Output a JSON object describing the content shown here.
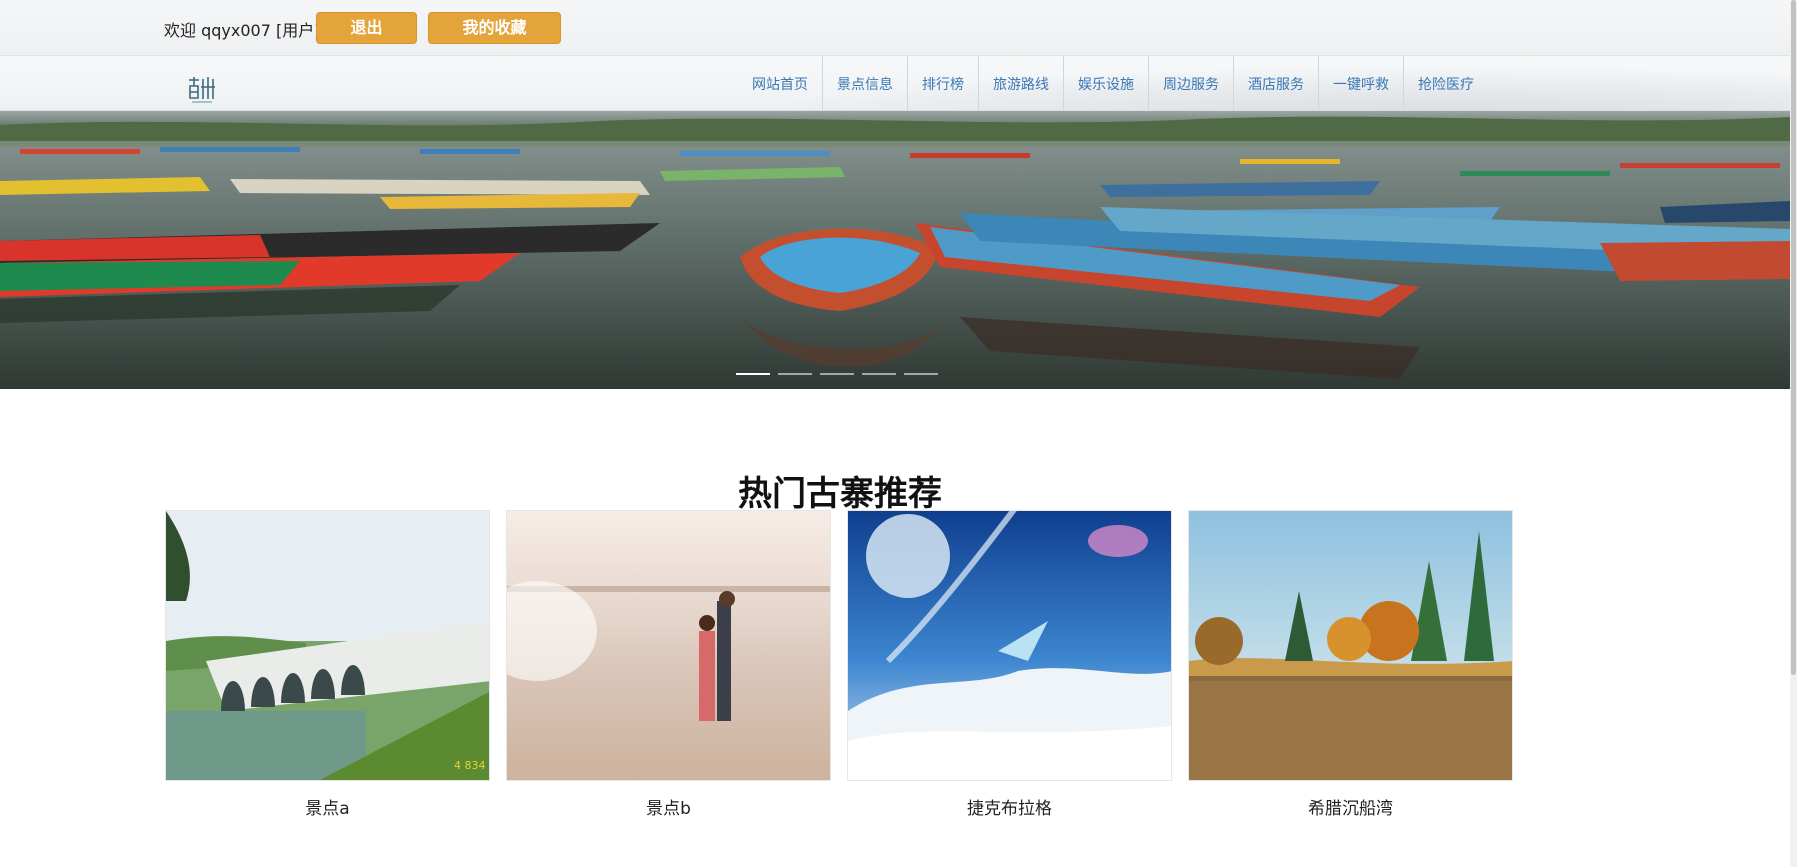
{
  "header": {
    "welcome_text": "欢迎 qqyx007 [用户]",
    "logout_label": "退出",
    "favorites_label": "我的收藏",
    "accent_color": "#e3a43a"
  },
  "nav": {
    "logo": "logo-icon",
    "items": [
      {
        "label": "网站首页"
      },
      {
        "label": "景点信息"
      },
      {
        "label": "排行榜"
      },
      {
        "label": "旅游路线"
      },
      {
        "label": "娱乐设施"
      },
      {
        "label": "周边服务"
      },
      {
        "label": "酒店服务"
      },
      {
        "label": "一键呼救"
      },
      {
        "label": "抢险医疗"
      }
    ]
  },
  "banner": {
    "slide_count": 5,
    "active_slide": 1
  },
  "section": {
    "title": "热门古寨推荐",
    "cards": [
      {
        "caption": "景点a"
      },
      {
        "caption": "景点b"
      },
      {
        "caption": "捷克布拉格"
      },
      {
        "caption": "希腊沉船湾"
      }
    ]
  }
}
